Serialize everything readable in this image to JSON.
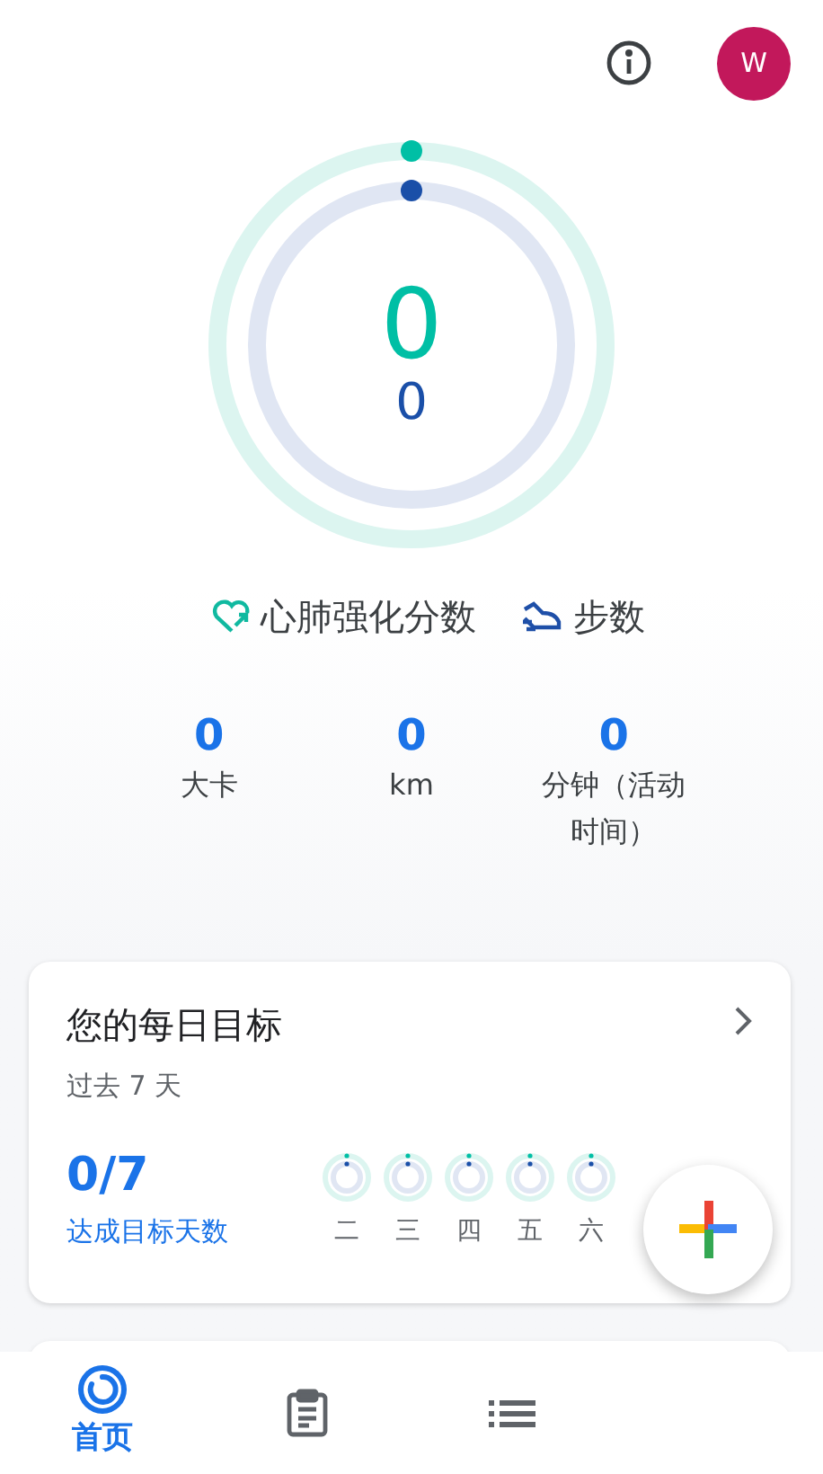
{
  "header": {
    "avatar_letter": "W"
  },
  "rings": {
    "cardio": {
      "value": "0"
    },
    "steps": {
      "value": "0"
    }
  },
  "legend": [
    {
      "kind": "heart",
      "label": "心肺强化分数"
    },
    {
      "kind": "shoe",
      "label": "步数"
    }
  ],
  "stats": [
    {
      "value": "0",
      "label": "大卡"
    },
    {
      "value": "0",
      "label": "km"
    },
    {
      "value": "0",
      "label": "分钟（活动时间）"
    }
  ],
  "daily_goals": {
    "title": "您的每日目标",
    "subtitle": "过去 7 天",
    "count": "0/7",
    "count_label": "达成目标天数",
    "days": [
      {
        "label": "二"
      },
      {
        "label": "三"
      },
      {
        "label": "四"
      },
      {
        "label": "五"
      },
      {
        "label": "六"
      }
    ]
  },
  "bottom_nav": [
    {
      "kind": "home",
      "label": "首页",
      "selected": true
    },
    {
      "kind": "journal",
      "selected": false
    },
    {
      "kind": "list",
      "selected": false
    }
  ]
}
